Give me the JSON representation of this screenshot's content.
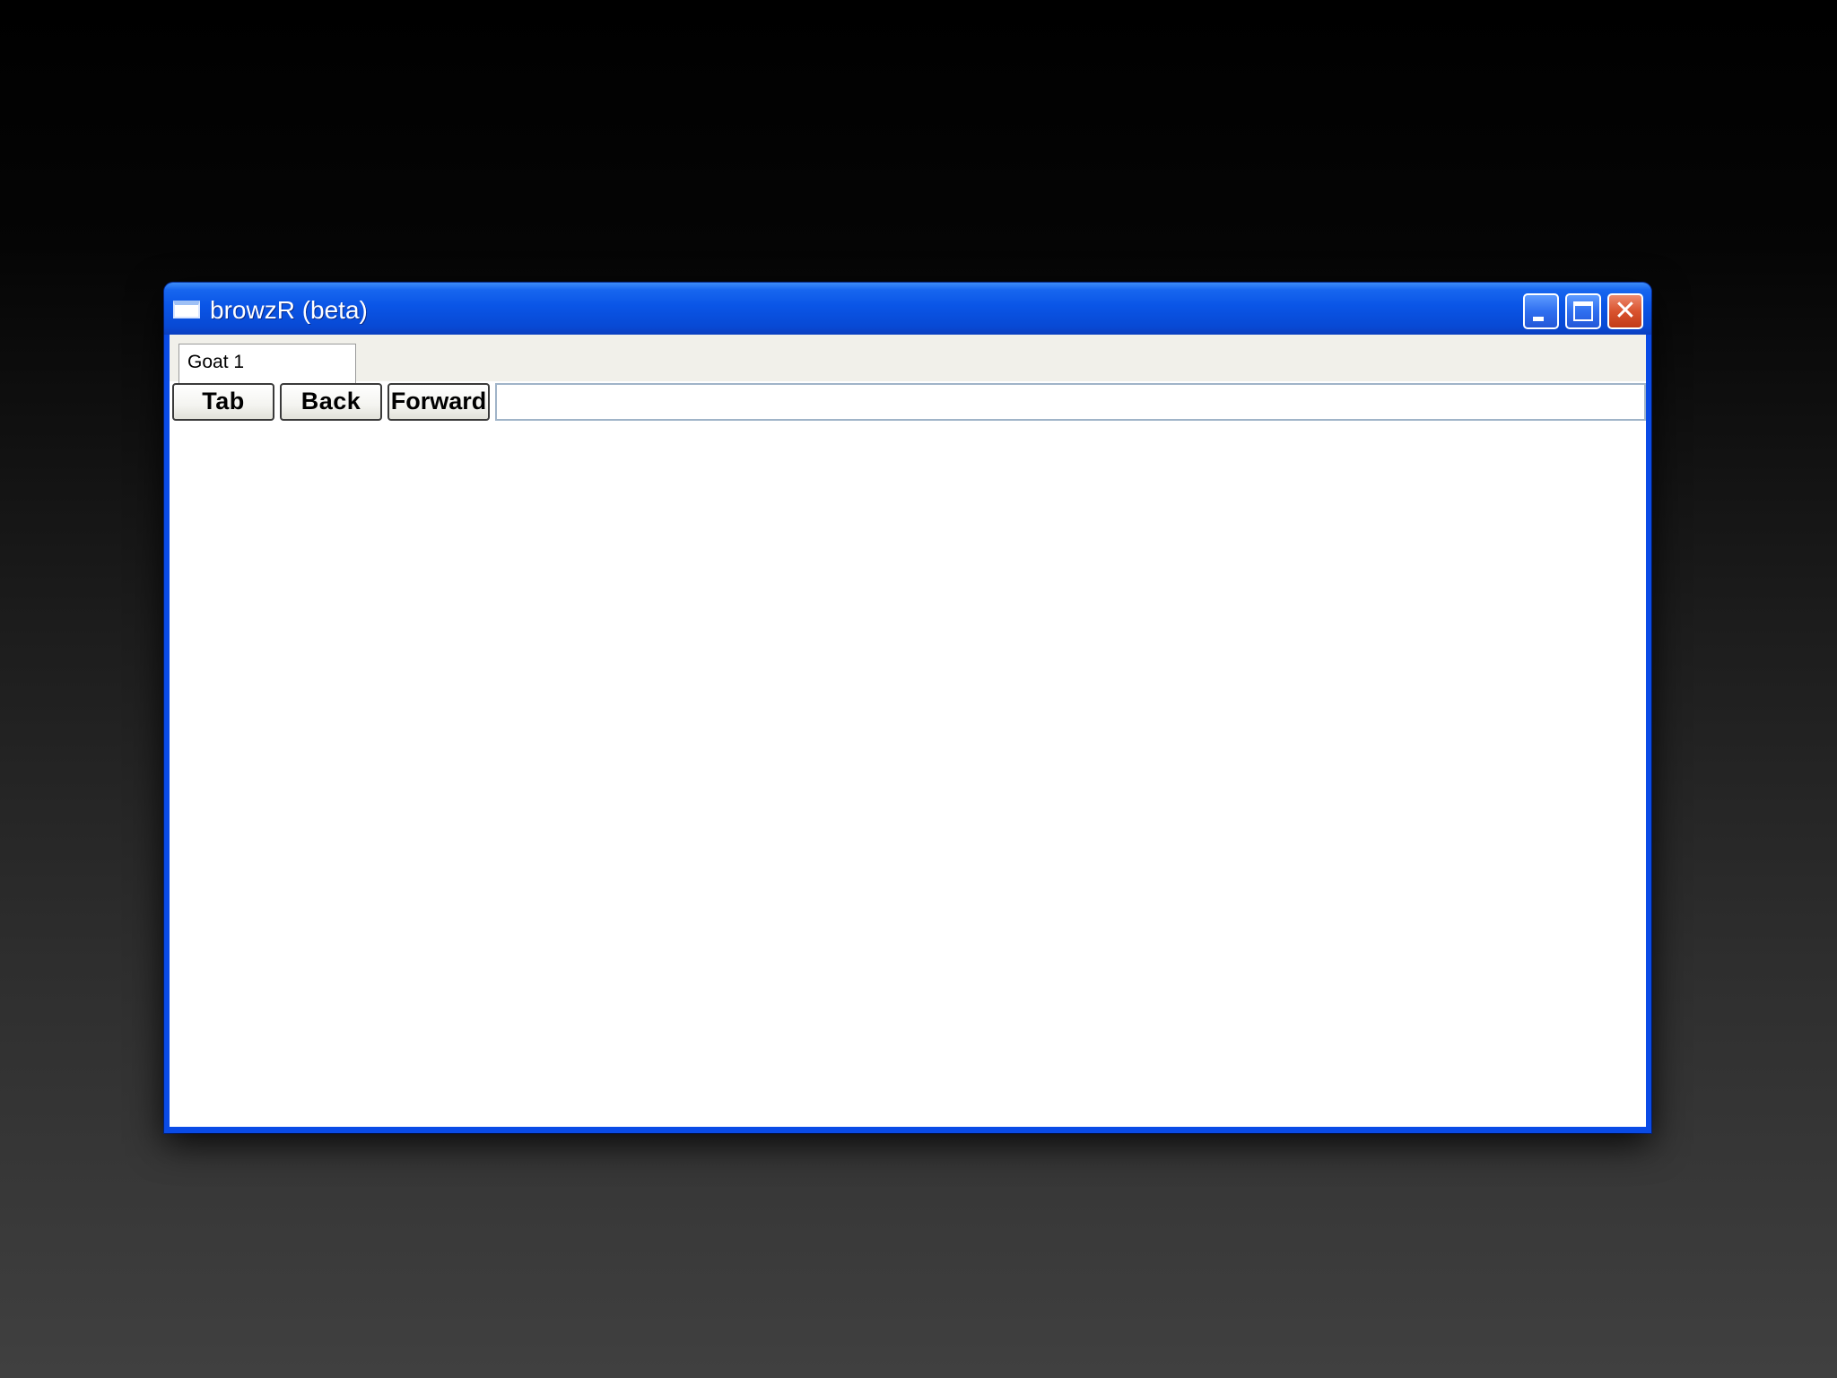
{
  "window": {
    "title": "browzR (beta)"
  },
  "tabs": [
    {
      "label": "Goat 1"
    }
  ],
  "toolbar": {
    "tab_label": "Tab",
    "back_label": "Back",
    "forward_label": "Forward"
  },
  "address_bar": {
    "value": ""
  },
  "icons": {
    "app": "window-icon",
    "minimize": "minimize-icon",
    "maximize": "maximize-icon",
    "close": "close-icon"
  }
}
